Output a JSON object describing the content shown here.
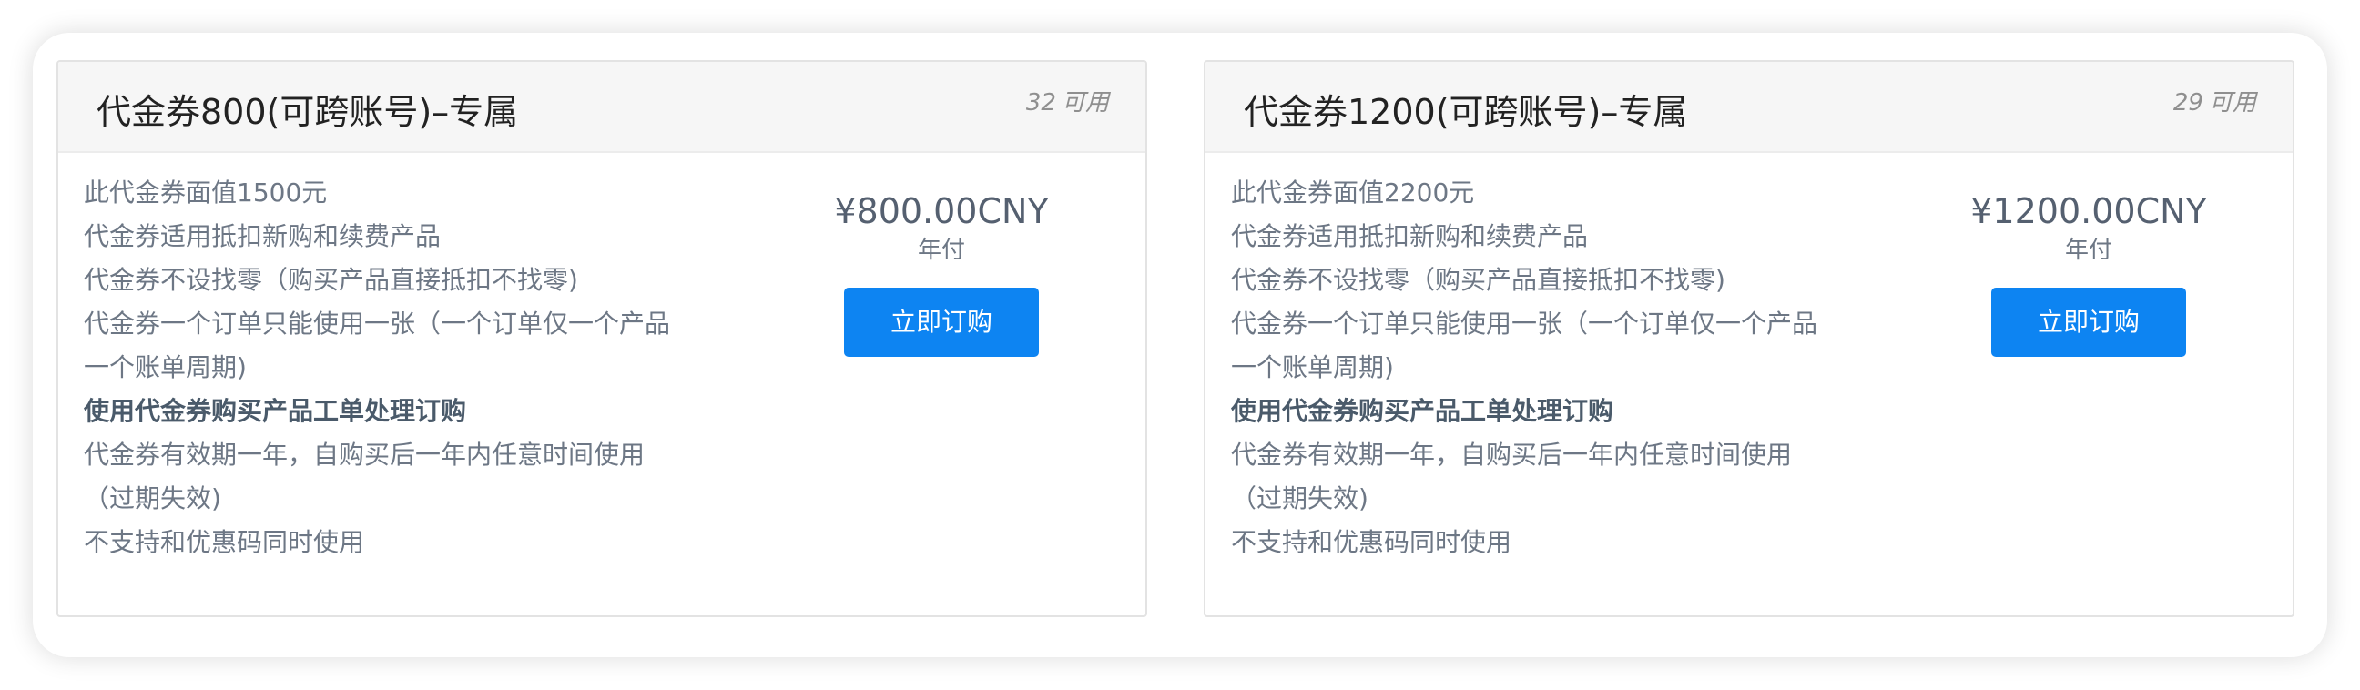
{
  "cards": [
    {
      "title": "代金券800(可跨账号)–专属",
      "available_count": "32",
      "available_label": "可用",
      "description": [
        "此代金券面值1500元",
        "代金券适用抵扣新购和续费产品",
        "代金券不设找零（购买产品直接抵扣不找零)",
        "代金券一个订单只能使用一张（一个订单仅一个产品",
        "一个账单周期)",
        "使用代金券购买产品工单处理订购",
        "代金券有效期一年，自购买后一年内任意时间使用",
        "（过期失效)",
        "不支持和优惠码同时使用"
      ],
      "price": "¥800.00CNY",
      "period": "年付",
      "button_label": "立即订购"
    },
    {
      "title": "代金券1200(可跨账号)–专属",
      "available_count": "29",
      "available_label": "可用",
      "description": [
        "此代金券面值2200元",
        "代金券适用抵扣新购和续费产品",
        "代金券不设找零（购买产品直接抵扣不找零)",
        "代金券一个订单只能使用一张（一个订单仅一个产品",
        "一个账单周期)",
        "使用代金券购买产品工单处理订购",
        "代金券有效期一年，自购买后一年内任意时间使用",
        "（过期失效)",
        "不支持和优惠码同时使用"
      ],
      "price": "¥1200.00CNY",
      "period": "年付",
      "button_label": "立即订购"
    }
  ],
  "colors": {
    "button": "#0d84f2",
    "header_bg": "#f6f6f6",
    "text": "#6d7785"
  }
}
